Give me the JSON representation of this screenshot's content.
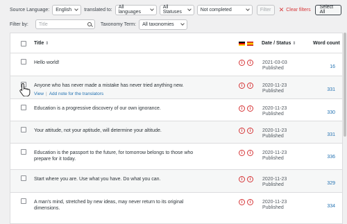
{
  "toolbar": {
    "source_label": "Source Language:",
    "source_value": "English",
    "translated_label": "translated to:",
    "languages_value": "All languages",
    "statuses_value": "All Statuses",
    "completion_value": "Not completed",
    "filter_label": "Filter",
    "clear_label": "Clear filters",
    "select_all_label": "Select All"
  },
  "filterbar": {
    "filter_by_label": "Filter by:",
    "search_placeholder": "Title",
    "taxonomy_label": "Taxonomy Term:",
    "taxonomy_value": "All taxonomies"
  },
  "table": {
    "headers": {
      "title": "Title",
      "date": "Date / Status",
      "word_count": "Word count"
    },
    "rows": [
      {
        "title": "Hello world!",
        "date": "2021-03-03",
        "status": "Published",
        "word_count": "16"
      },
      {
        "title": "Anyone who has never made a mistake has never tried anything new.",
        "date": "2020-11-23",
        "status": "Published",
        "word_count": "331",
        "action_view": "View",
        "action_note": "Add note for the translators"
      },
      {
        "title": "Education is a progressive discovery of our own ignorance.",
        "date": "2020-11-23",
        "status": "Published",
        "word_count": "330"
      },
      {
        "title": "Your attitude, not your aptitude, will determine your altitude.",
        "date": "2020-11-23",
        "status": "Published",
        "word_count": "331"
      },
      {
        "title": "Education is the passport to the future, for tomorrow belongs to those who prepare for it today.",
        "date": "2020-11-23",
        "status": "Published",
        "word_count": "336"
      },
      {
        "title": "Start where you are. Use what you have. Do what you can.",
        "date": "2020-11-23",
        "status": "Published",
        "word_count": "329"
      },
      {
        "title": "A man's mind, stretched by new ideas, may never return to its original dimensions.",
        "date": "2020-11-23",
        "status": "Published",
        "word_count": "334"
      }
    ],
    "status_icon_glyph": "i",
    "colors": {
      "link": "#2271b1",
      "status_icon": "#d63638"
    },
    "flags": [
      "german-flag-icon",
      "spanish-flag-icon"
    ]
  }
}
